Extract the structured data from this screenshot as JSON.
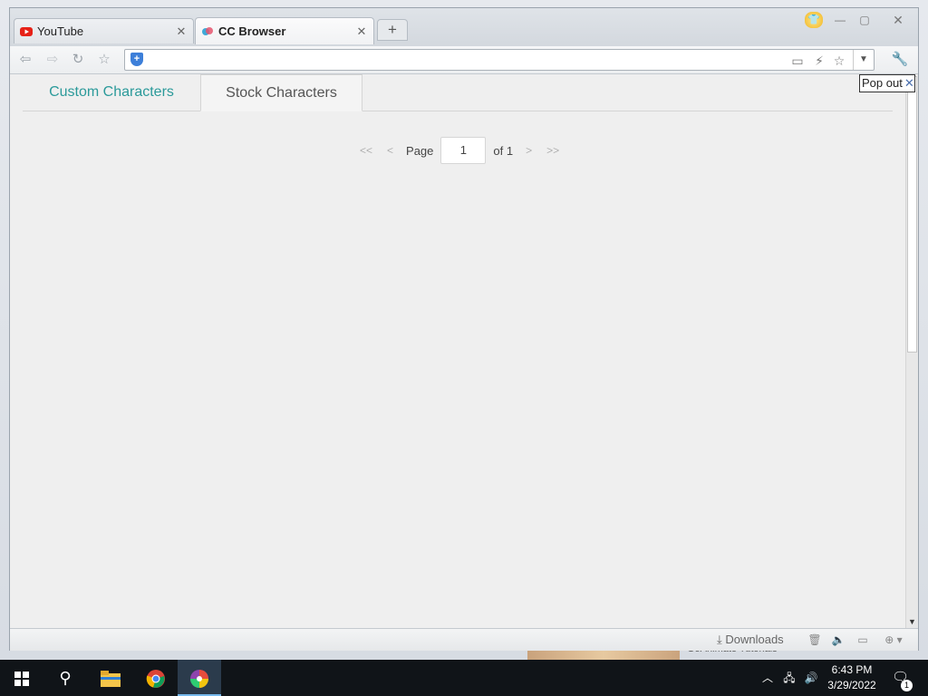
{
  "browser": {
    "tabs": [
      {
        "title": "YouTube",
        "icon": "youtube-icon",
        "active": false
      },
      {
        "title": "CC Browser",
        "icon": "cc-browser-icon",
        "active": true
      }
    ],
    "new_tab_glyph": "+",
    "popout_label": "Pop out",
    "popout_close": "✕",
    "status_downloads": "Downloads"
  },
  "page": {
    "tabs": [
      {
        "label": "Custom Characters",
        "active": false
      },
      {
        "label": "Stock Characters",
        "active": true
      }
    ],
    "pager": {
      "first": "<<",
      "prev": "<",
      "page_label": "Page",
      "current_page": "1",
      "of_label": "of 1",
      "next": ">",
      "last": ">>"
    }
  },
  "desktop": {
    "peek_text": "GoAnimate Tutorials"
  },
  "taskbar": {
    "time": "6:43 PM",
    "date": "3/29/2022",
    "notification_count": "1"
  },
  "colors": {
    "accent_teal": "#2b9a9a",
    "taskbar": "#101418",
    "content_bg": "#efefef"
  }
}
